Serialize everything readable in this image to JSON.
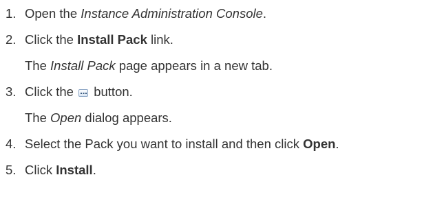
{
  "steps": [
    {
      "number": "1.",
      "parts": [
        "Open the ",
        "Instance Administration Console",
        "."
      ]
    },
    {
      "number": "2.",
      "parts": [
        "Click the ",
        "Install Pack",
        " link."
      ],
      "note_parts": [
        "The ",
        "Install Pack",
        " page appears in a new tab."
      ]
    },
    {
      "number": "3.",
      "parts": [
        "Click the ",
        " button."
      ],
      "note_parts": [
        "The ",
        "Open",
        " dialog appears."
      ]
    },
    {
      "number": "4.",
      "parts": [
        "Select the Pack you want to install and then click ",
        "Open",
        "."
      ]
    },
    {
      "number": "5.",
      "parts": [
        "Click ",
        "Install",
        "."
      ]
    }
  ],
  "icons": {
    "browse_button": "ellipsis-browse-icon"
  }
}
